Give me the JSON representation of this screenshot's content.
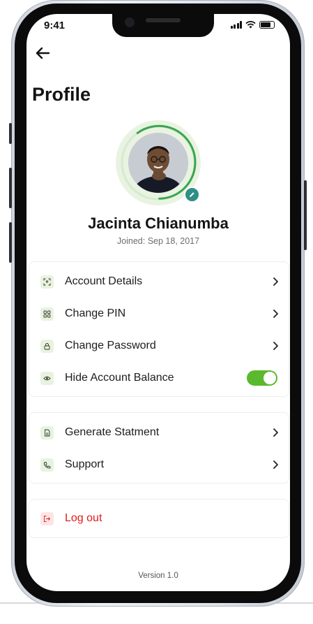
{
  "status_bar": {
    "time": "9:41",
    "signal_icon": "signal-icon",
    "wifi_icon": "wifi-icon",
    "battery_icon": "battery-icon"
  },
  "header": {
    "back_icon": "arrow-left-icon",
    "title": "Profile"
  },
  "profile": {
    "name": "Jacinta Chianumba",
    "joined": "Joined: Sep 18, 2017",
    "edit_icon": "pencil-icon"
  },
  "menu_group_1": [
    {
      "label": "Account Details",
      "icon": "face-scan-icon",
      "action": "chevron-right-icon"
    },
    {
      "label": "Change PIN",
      "icon": "grid-icon",
      "action": "chevron-right-icon"
    },
    {
      "label": "Change Password",
      "icon": "lock-icon",
      "action": "chevron-right-icon"
    },
    {
      "label": "Hide Account Balance",
      "icon": "eye-icon",
      "toggle_on": true
    }
  ],
  "menu_group_2": [
    {
      "label": "Generate Statment",
      "icon": "document-icon",
      "action": "chevron-right-icon"
    },
    {
      "label": "Support",
      "icon": "phone-icon",
      "action": "chevron-right-icon"
    }
  ],
  "logout": {
    "label": "Log out",
    "icon": "logout-icon"
  },
  "footer": {
    "version": "Version 1.0"
  },
  "colors": {
    "accent_green": "#5bb92e",
    "icon_bg_green": "#e8f3df",
    "danger_red": "#e11b1b",
    "teal_badge": "#2f8f86"
  }
}
